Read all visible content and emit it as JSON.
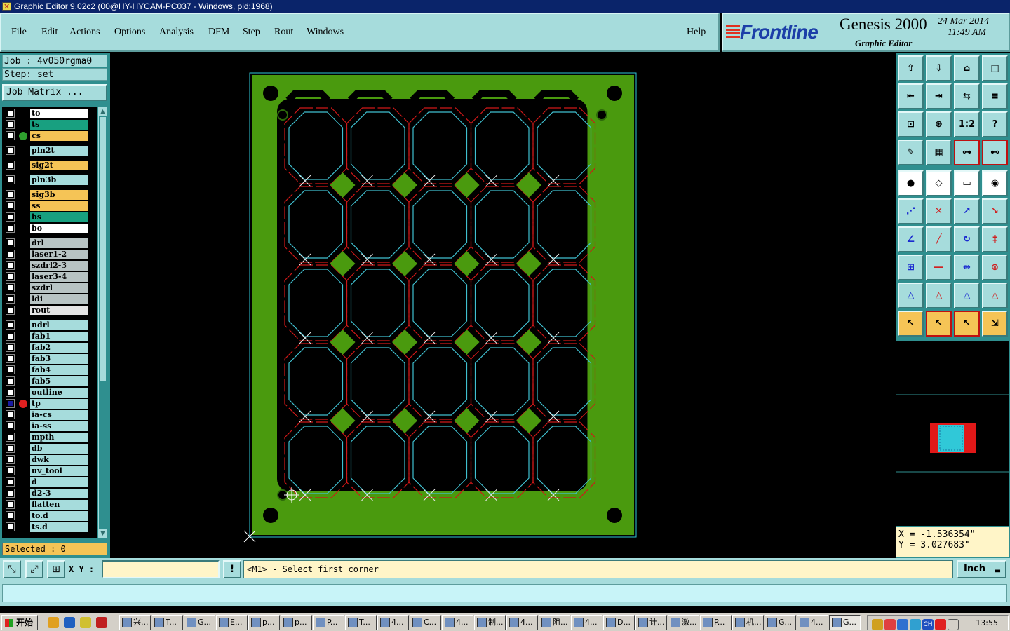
{
  "window": {
    "title": "Graphic Editor 9.02c2 (00@HY-HYCAM-PC037 - Windows, pid:1968)"
  },
  "menu": [
    "File",
    "Edit",
    "Actions",
    "Options",
    "Analysis",
    "DFM",
    "Step",
    "Rout",
    "Windows"
  ],
  "help_label": "Help",
  "brand": {
    "logo": "Frontline",
    "product": "Genesis 2000",
    "subtitle": "Graphic Editor",
    "date": "24 Mar 2014",
    "time": "11:49 AM"
  },
  "job": {
    "job_label": "Job : 4v050rgma0",
    "step_label": "Step: set",
    "job_matrix": "Job Matrix ..."
  },
  "layers": [
    {
      "name": "to",
      "color": "#ffffff",
      "dot": ""
    },
    {
      "name": "ts",
      "color": "#18a080",
      "dot": ""
    },
    {
      "name": "cs",
      "color": "#f5c456",
      "dot": "#2ea02e"
    },
    {
      "name": "pln2t",
      "color": "#a6dcdc",
      "dot": ""
    },
    {
      "name": "sig2t",
      "color": "#f5c456",
      "dot": ""
    },
    {
      "name": "pln3b",
      "color": "#a6dcdc",
      "dot": ""
    },
    {
      "name": "sig3b",
      "color": "#f5c456",
      "dot": ""
    },
    {
      "name": "ss",
      "color": "#f5c456",
      "dot": ""
    },
    {
      "name": "bs",
      "color": "#18a080",
      "dot": ""
    },
    {
      "name": "bo",
      "color": "#ffffff",
      "dot": ""
    },
    {
      "name": "drl",
      "color": "#b8c4c4",
      "dot": ""
    },
    {
      "name": "laser1-2",
      "color": "#b8c4c4",
      "dot": ""
    },
    {
      "name": "szdrl2-3",
      "color": "#b8c4c4",
      "dot": ""
    },
    {
      "name": "laser3-4",
      "color": "#b8c4c4",
      "dot": ""
    },
    {
      "name": "szdrl",
      "color": "#b8c4c4",
      "dot": ""
    },
    {
      "name": "ldi",
      "color": "#b8c4c4",
      "dot": ""
    },
    {
      "name": "rout",
      "color": "#e4e4e4",
      "dot": ""
    },
    {
      "name": "ndrl",
      "color": "#a6dcdc",
      "dot": ""
    },
    {
      "name": "fab1",
      "color": "#a6dcdc",
      "dot": ""
    },
    {
      "name": "fab2",
      "color": "#a6dcdc",
      "dot": ""
    },
    {
      "name": "fab3",
      "color": "#a6dcdc",
      "dot": ""
    },
    {
      "name": "fab4",
      "color": "#a6dcdc",
      "dot": ""
    },
    {
      "name": "fab5",
      "color": "#a6dcdc",
      "dot": ""
    },
    {
      "name": "outline",
      "color": "#a6dcdc",
      "dot": ""
    },
    {
      "name": "tp",
      "color": "#a6dcdc",
      "dot": "#e02020"
    },
    {
      "name": "ia-cs",
      "color": "#a6dcdc",
      "dot": ""
    },
    {
      "name": "ia-ss",
      "color": "#a6dcdc",
      "dot": ""
    },
    {
      "name": "mpth",
      "color": "#a6dcdc",
      "dot": ""
    },
    {
      "name": "db",
      "color": "#a6dcdc",
      "dot": ""
    },
    {
      "name": "dwk",
      "color": "#a6dcdc",
      "dot": ""
    },
    {
      "name": "uv_tool",
      "color": "#a6dcdc",
      "dot": ""
    },
    {
      "name": "d",
      "color": "#a6dcdc",
      "dot": ""
    },
    {
      "name": "d2-3",
      "color": "#a6dcdc",
      "dot": ""
    },
    {
      "name": "flatten",
      "color": "#a6dcdc",
      "dot": ""
    },
    {
      "name": "to.d",
      "color": "#a6dcdc",
      "dot": ""
    },
    {
      "name": "ts.d",
      "color": "#a6dcdc",
      "dot": ""
    }
  ],
  "selected_label": "Selected : 0",
  "coords": {
    "x": "X = -1.536354\"",
    "y": "Y = 3.027683\""
  },
  "command": {
    "xy_label": "X Y :",
    "xy_value": "",
    "prompt": "<M1> - Select first corner",
    "units": "Inch"
  },
  "toolbar_icons": [
    "zoom-home-icon",
    "zoom-fit-icon",
    "home-icon",
    "split-view-icon",
    "zoom-out-icon",
    "zoom-in-icon",
    "scale-icon",
    "alternate-icon",
    "fit-window-icon",
    "center-icon",
    "ratio-icon",
    "help-icon",
    "measure-icon",
    "grid-icon",
    "snap-icon",
    "snap2-icon",
    "feature-icon",
    "edit-shape-icon",
    "ruler-icon",
    "pad-icon",
    "connect-icon",
    "delete-icon",
    "move-icon",
    "copy-icon",
    "angle-icon",
    "line-icon",
    "arc-icon",
    "text-icon",
    "transform-icon",
    "align-icon",
    "dimension-icon",
    "shape-icon",
    "triangle-icon",
    "triangle2-icon",
    "triangle3-icon",
    "triangle4-icon",
    "select-icon",
    "select-box-icon",
    "select-rect-icon",
    "select-net-icon"
  ],
  "ratio_label": "1:2",
  "taskbar": {
    "start": "开始",
    "clock": "13:55",
    "buttons": [
      "兴...",
      "T...",
      "G...",
      "E...",
      "p...",
      "p...",
      "P...",
      "T...",
      "4...",
      "C...",
      "4...",
      "制...",
      "4...",
      "阻...",
      "4...",
      "D...",
      "计...",
      "激...",
      "P...",
      "机...",
      "G...",
      "4...",
      "G..."
    ]
  }
}
